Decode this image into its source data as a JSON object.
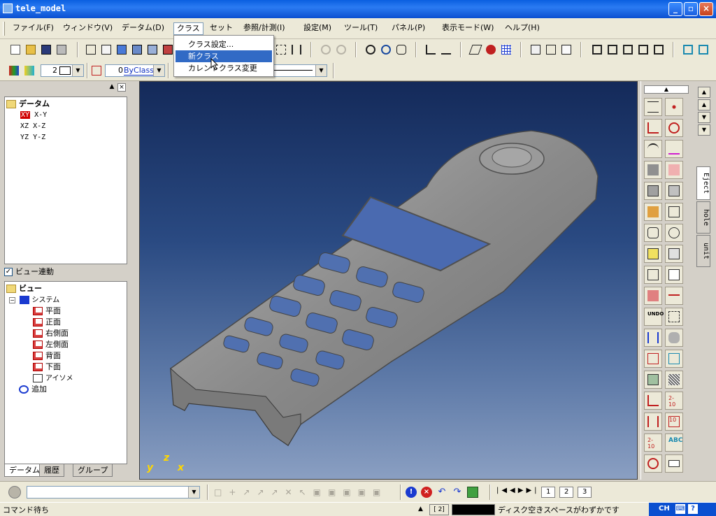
{
  "window": {
    "title": "tele_model"
  },
  "menu": {
    "items": [
      "ファイル(F)",
      "ウィンドウ(V)",
      "データム(D)",
      "クラス",
      "セット",
      "参照/計測(I)",
      "設定(M)",
      "ツール(T)",
      "パネル(P)",
      "表示モード(W)",
      "ヘルプ(H)"
    ],
    "active": "クラス"
  },
  "class_menu": {
    "items": [
      "クラス設定...",
      "新クラス",
      "カレントクラス変更"
    ],
    "highlighted": "新クラス"
  },
  "toolbar2": {
    "linewidth_value": "2",
    "class_num": "0",
    "class_value": "ByClass"
  },
  "datum_tree": {
    "root": "データム",
    "items": [
      {
        "code": "XY",
        "name": "X-Y"
      },
      {
        "code": "XZ",
        "name": "X-Z"
      },
      {
        "code": "YZ",
        "name": "Y-Z"
      }
    ]
  },
  "view_link": {
    "label": "ビュー連動",
    "checked": true
  },
  "view_tree": {
    "root": "ビュー",
    "system": "システム",
    "views": [
      "平面",
      "正面",
      "右側面",
      "左側面",
      "背面",
      "下面",
      "アイソメ"
    ],
    "add": "追加"
  },
  "left_tabs": [
    "データム",
    "履歴",
    "グループ"
  ],
  "viewport": {
    "axes": {
      "y": "y",
      "z": "z",
      "x": "x"
    }
  },
  "palette_side_tabs": [
    "Eject",
    "hole",
    "unit"
  ],
  "bottom_pages": [
    "1",
    "2",
    "3"
  ],
  "status": {
    "text": "コマンド待ち",
    "mini": "2",
    "warning": "ディスク空きスペースがわずかです",
    "tray_lang": "CH"
  },
  "colors": {
    "titlebar": "#0a5fe0",
    "menu_highlight": "#316ac5",
    "viewport_top": "#142a5a",
    "viewport_bottom": "#8a9fc2"
  }
}
